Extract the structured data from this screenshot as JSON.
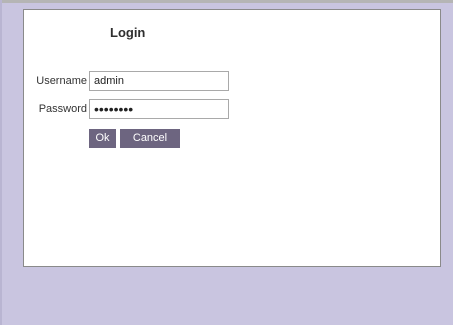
{
  "login": {
    "title": "Login",
    "username_label": "Username",
    "username_value": "admin",
    "password_label": "Password",
    "password_value": "password",
    "ok_label": "Ok",
    "cancel_label": "Cancel"
  },
  "colors": {
    "page_background": "#c9c5e0",
    "panel_background": "#ffffff",
    "button_background": "#6d6580",
    "button_text": "#ffffff"
  }
}
